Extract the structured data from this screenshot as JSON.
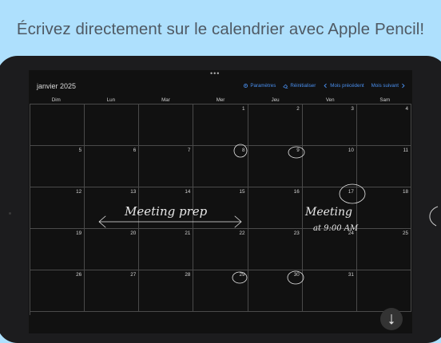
{
  "banner": {
    "title": "Écrivez directement sur le calendrier avec Apple Pencil!"
  },
  "calendar": {
    "month_title": "janvier 2025",
    "toolbar": {
      "settings": "Paramètres",
      "reset": "Réinitialiser",
      "prev": "Mois précédent",
      "next": "Mois suivant"
    },
    "weekdays": [
      "Dim",
      "Lun",
      "Mar",
      "Mer",
      "Jeu",
      "Ven",
      "Sam"
    ],
    "weeks": [
      [
        "",
        "",
        "",
        "1",
        "2",
        "3",
        "4"
      ],
      [
        "5",
        "6",
        "7",
        "8",
        "9",
        "10",
        "11"
      ],
      [
        "12",
        "13",
        "14",
        "15",
        "16",
        "17",
        "18"
      ],
      [
        "19",
        "20",
        "21",
        "22",
        "23",
        "24",
        "25"
      ],
      [
        "26",
        "27",
        "28",
        "29",
        "30",
        "31",
        ""
      ]
    ],
    "handwriting": {
      "note1": "Meeting prep",
      "note2_line1": "Meeting",
      "note2_line2": "at 9:00 AM"
    }
  },
  "colors": {
    "accent": "#4a90f0",
    "banner_bg": "#aee0fd",
    "ink": "#e8e8e8"
  }
}
